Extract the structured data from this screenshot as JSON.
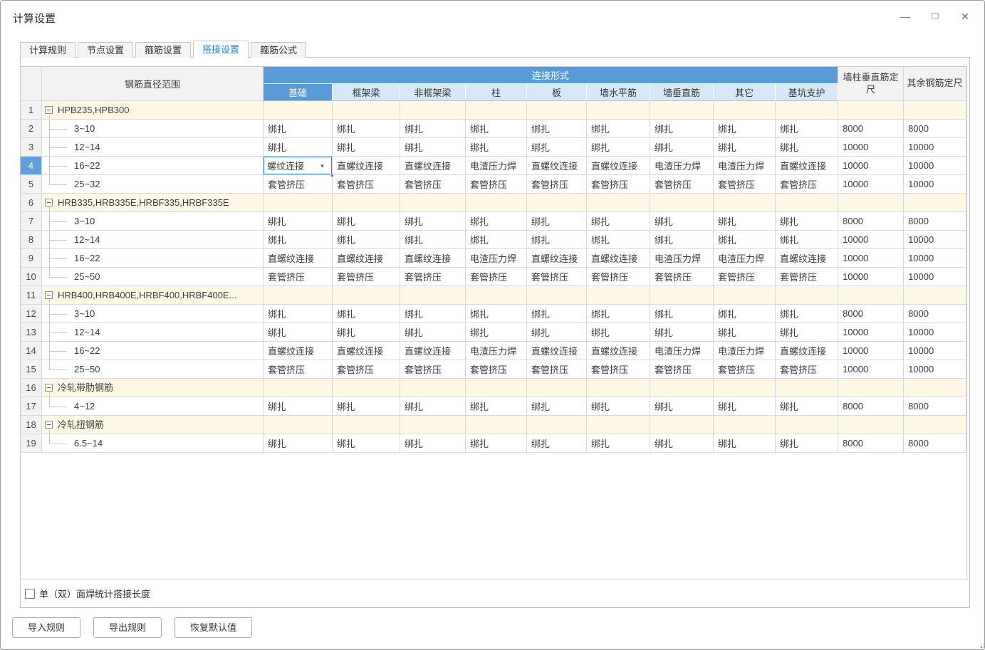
{
  "window": {
    "title": "计算设置"
  },
  "icons": {
    "minimize": "—",
    "maximize": "□",
    "close": "✕",
    "dropdown_arrow": "▼",
    "collapse": "−"
  },
  "tabs": [
    {
      "label": "计算规则",
      "active": false
    },
    {
      "label": "节点设置",
      "active": false
    },
    {
      "label": "箍筋设置",
      "active": false
    },
    {
      "label": "搭接设置",
      "active": true
    },
    {
      "label": "箍筋公式",
      "active": false
    }
  ],
  "table": {
    "headers": {
      "diameter_range": "钢筋直径范围",
      "connection_group": "连接形式",
      "sub_columns": [
        "基础",
        "框架梁",
        "非框架梁",
        "柱",
        "板",
        "墙水平筋",
        "墙垂直筋",
        "其它",
        "基坑支护"
      ],
      "wall_col_fixed": "墙柱垂直筋定尺",
      "other_fixed": "其余钢筋定尺"
    },
    "rows": [
      {
        "num": "1",
        "type": "group",
        "label": "HPB235,HPB300"
      },
      {
        "num": "2",
        "type": "data",
        "range": "3~10",
        "connections": [
          "绑扎",
          "绑扎",
          "绑扎",
          "绑扎",
          "绑扎",
          "绑扎",
          "绑扎",
          "绑扎",
          "绑扎"
        ],
        "wall_fixed": "8000",
        "other_fixed": "8000"
      },
      {
        "num": "3",
        "type": "data",
        "range": "12~14",
        "connections": [
          "绑扎",
          "绑扎",
          "绑扎",
          "绑扎",
          "绑扎",
          "绑扎",
          "绑扎",
          "绑扎",
          "绑扎"
        ],
        "wall_fixed": "10000",
        "other_fixed": "10000"
      },
      {
        "num": "4",
        "type": "data",
        "range": "16~22",
        "connections": [
          "螺纹连接",
          "直螺纹连接",
          "直螺纹连接",
          "电渣压力焊",
          "直螺纹连接",
          "直螺纹连接",
          "电渣压力焊",
          "电渣压力焊",
          "直螺纹连接"
        ],
        "wall_fixed": "10000",
        "other_fixed": "10000"
      },
      {
        "num": "5",
        "type": "data",
        "range": "25~32",
        "connections": [
          "套管挤压",
          "套管挤压",
          "套管挤压",
          "套管挤压",
          "套管挤压",
          "套管挤压",
          "套管挤压",
          "套管挤压",
          "套管挤压"
        ],
        "wall_fixed": "10000",
        "other_fixed": "10000"
      },
      {
        "num": "6",
        "type": "group",
        "label": "HRB335,HRB335E,HRBF335,HRBF335E"
      },
      {
        "num": "7",
        "type": "data",
        "range": "3~10",
        "connections": [
          "绑扎",
          "绑扎",
          "绑扎",
          "绑扎",
          "绑扎",
          "绑扎",
          "绑扎",
          "绑扎",
          "绑扎"
        ],
        "wall_fixed": "8000",
        "other_fixed": "8000"
      },
      {
        "num": "8",
        "type": "data",
        "range": "12~14",
        "connections": [
          "绑扎",
          "绑扎",
          "绑扎",
          "绑扎",
          "绑扎",
          "绑扎",
          "绑扎",
          "绑扎",
          "绑扎"
        ],
        "wall_fixed": "10000",
        "other_fixed": "10000"
      },
      {
        "num": "9",
        "type": "data",
        "range": "16~22",
        "connections": [
          "直螺纹连接",
          "直螺纹连接",
          "直螺纹连接",
          "电渣压力焊",
          "直螺纹连接",
          "直螺纹连接",
          "电渣压力焊",
          "电渣压力焊",
          "直螺纹连接"
        ],
        "wall_fixed": "10000",
        "other_fixed": "10000"
      },
      {
        "num": "10",
        "type": "data",
        "range": "25~50",
        "connections": [
          "套管挤压",
          "套管挤压",
          "套管挤压",
          "套管挤压",
          "套管挤压",
          "套管挤压",
          "套管挤压",
          "套管挤压",
          "套管挤压"
        ],
        "wall_fixed": "10000",
        "other_fixed": "10000"
      },
      {
        "num": "11",
        "type": "group",
        "label": "HRB400,HRB400E,HRBF400,HRBF400E..."
      },
      {
        "num": "12",
        "type": "data",
        "range": "3~10",
        "connections": [
          "绑扎",
          "绑扎",
          "绑扎",
          "绑扎",
          "绑扎",
          "绑扎",
          "绑扎",
          "绑扎",
          "绑扎"
        ],
        "wall_fixed": "8000",
        "other_fixed": "8000"
      },
      {
        "num": "13",
        "type": "data",
        "range": "12~14",
        "connections": [
          "绑扎",
          "绑扎",
          "绑扎",
          "绑扎",
          "绑扎",
          "绑扎",
          "绑扎",
          "绑扎",
          "绑扎"
        ],
        "wall_fixed": "10000",
        "other_fixed": "10000"
      },
      {
        "num": "14",
        "type": "data",
        "range": "16~22",
        "connections": [
          "直螺纹连接",
          "直螺纹连接",
          "直螺纹连接",
          "电渣压力焊",
          "直螺纹连接",
          "直螺纹连接",
          "电渣压力焊",
          "电渣压力焊",
          "直螺纹连接"
        ],
        "wall_fixed": "10000",
        "other_fixed": "10000"
      },
      {
        "num": "15",
        "type": "data",
        "range": "25~50",
        "connections": [
          "套管挤压",
          "套管挤压",
          "套管挤压",
          "套管挤压",
          "套管挤压",
          "套管挤压",
          "套管挤压",
          "套管挤压",
          "套管挤压"
        ],
        "wall_fixed": "10000",
        "other_fixed": "10000"
      },
      {
        "num": "16",
        "type": "group",
        "label": "冷轧带肋钢筋"
      },
      {
        "num": "17",
        "type": "data",
        "range": "4~12",
        "connections": [
          "绑扎",
          "绑扎",
          "绑扎",
          "绑扎",
          "绑扎",
          "绑扎",
          "绑扎",
          "绑扎",
          "绑扎"
        ],
        "wall_fixed": "8000",
        "other_fixed": "8000"
      },
      {
        "num": "18",
        "type": "group",
        "label": "冷轧扭钢筋"
      },
      {
        "num": "19",
        "type": "data",
        "range": "6.5~14",
        "connections": [
          "绑扎",
          "绑扎",
          "绑扎",
          "绑扎",
          "绑扎",
          "绑扎",
          "绑扎",
          "绑扎",
          "绑扎"
        ],
        "wall_fixed": "8000",
        "other_fixed": "8000"
      }
    ],
    "selection": {
      "row_num": "4",
      "column": "基础",
      "editor_value": "螺纹连接"
    }
  },
  "footer": {
    "checkbox_label": "单（双）面焊统计搭接长度",
    "checkbox_checked": false
  },
  "action_buttons": [
    {
      "label": "导入规则"
    },
    {
      "label": "导出规则"
    },
    {
      "label": "恢复默认值"
    }
  ],
  "colors": {
    "header_blue": "#5B9BD5",
    "header_light_blue": "#D6E8F8",
    "group_row_yellow": "#FCF8E5",
    "selection_blue": "#2F7FD6",
    "selected_row_header": "#5F9FDB",
    "accent_blue": "#2E7FD4"
  }
}
